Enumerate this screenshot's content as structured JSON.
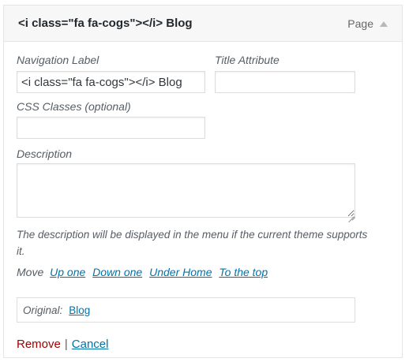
{
  "header": {
    "title": "<i class=\"fa fa-cogs\"></i> Blog",
    "item_type": "Page",
    "collapse_icon": "triangle-up-icon"
  },
  "fields": {
    "navigation_label": {
      "label": "Navigation Label",
      "value": "<i class=\"fa fa-cogs\"></i> Blog"
    },
    "title_attribute": {
      "label": "Title Attribute",
      "value": ""
    },
    "css_classes": {
      "label": "CSS Classes (optional)",
      "value": ""
    },
    "description": {
      "label": "Description",
      "value": "",
      "hint": "The description will be displayed in the menu if the current theme supports it."
    }
  },
  "move": {
    "label": "Move",
    "links": [
      "Up one",
      "Down one",
      "Under Home",
      "To the top"
    ]
  },
  "original": {
    "label": "Original:",
    "link": "Blog"
  },
  "actions": {
    "remove": "Remove",
    "separator": "|",
    "cancel": "Cancel"
  },
  "colors": {
    "link": "#0073aa",
    "remove": "#a00000",
    "header_bg": "#f7f7f7",
    "border": "#dddddd"
  }
}
